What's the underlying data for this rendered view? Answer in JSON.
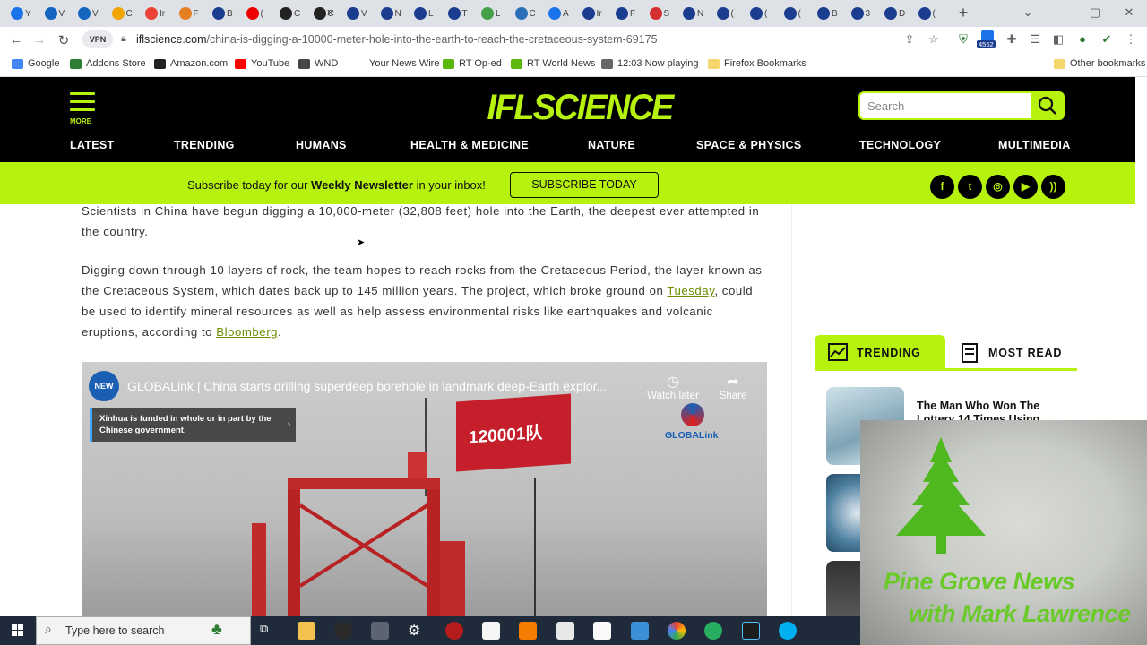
{
  "browser": {
    "tabs": [
      "Y",
      "V",
      "V",
      "C",
      "Ir",
      "F",
      "B",
      "(",
      "C",
      "C",
      "V",
      "N",
      "L",
      "T",
      "L",
      "C",
      "A",
      "Ir",
      "F",
      "S",
      "N",
      "(",
      "(",
      "(",
      "B",
      "3",
      "D",
      "("
    ],
    "new_tab": "+",
    "url_host": "iflscience.com",
    "url_path": "/china-is-digging-a-10000-meter-hole-into-the-earth-to-reach-the-cretaceous-system-69175",
    "vpn_label": "VPN",
    "extension_badge": "4552"
  },
  "bookmarks": [
    {
      "label": "Google",
      "color": "#4285f4"
    },
    {
      "label": "Addons Store",
      "color": "#2e7d32"
    },
    {
      "label": "Amazon.com",
      "color": "#222222"
    },
    {
      "label": "YouTube",
      "color": "#ff0000"
    },
    {
      "label": "WND",
      "color": "#444444"
    },
    {
      "label": "Your News Wire",
      "color": "#ffffff"
    },
    {
      "label": "RT Op-ed",
      "color": "#5cb80b"
    },
    {
      "label": "RT World News",
      "color": "#5cb80b"
    },
    {
      "label": "12:03  Now playing",
      "color": "#666666"
    },
    {
      "label": "Firefox Bookmarks",
      "color": "#f5d76e"
    }
  ],
  "other_bookmarks": "Other bookmarks",
  "site": {
    "logo": "IFLSCIENCE",
    "more_label": "MORE",
    "search_placeholder": "Search",
    "nav": [
      "LATEST",
      "TRENDING",
      "HUMANS",
      "HEALTH & MEDICINE",
      "NATURE",
      "SPACE & PHYSICS",
      "TECHNOLOGY",
      "MULTIMEDIA"
    ],
    "accent_color": "#b6f20e"
  },
  "newsletter": {
    "pre": "Subscribe today for our ",
    "bold": "Weekly Newsletter",
    "post": " in your inbox!",
    "button": "SUBSCRIBE TODAY",
    "socials": [
      "facebook-icon",
      "twitter-icon",
      "instagram-icon",
      "youtube-icon",
      "rss-icon"
    ]
  },
  "article": {
    "p1": "Scientists in China have begun digging a 10,000-meter (32,808 feet) hole into the Earth, the deepest ever attempted in the country.",
    "p2_before": "Digging down through 10 layers of rock, the team hopes to reach rocks from the Cretaceous Period, the layer known as the Cretaceous System, which dates back up to 145 million years. The project, which broke ground on ",
    "p2_link1": "Tuesday",
    "p2_middle": ", could be used to identify mineral resources as well as help assess environmental risks like earthquakes and volcanic eruptions, according to ",
    "p2_link2": "Bloomberg",
    "p2_end": "."
  },
  "video": {
    "channel_badge": "NEW CHINA",
    "title": "GLOBALink | China starts drilling superdeep borehole in landmark deep-Earth explor...",
    "funding_notice": "Xinhua is funded in whole or in part by the Chinese government.",
    "watch_later": "Watch later",
    "share": "Share",
    "watermark": "GLOBALink",
    "flag_text": "120001队"
  },
  "sidebar": {
    "tab_trending": "TRENDING",
    "tab_most_read": "MOST READ",
    "story1": "The Man Who Won The Lottery 14 Times Using"
  },
  "overlay": {
    "line1": "Pine Grove News",
    "line2": "with Mark Lawrence"
  },
  "taskbar": {
    "search_placeholder": "Type here to search"
  }
}
